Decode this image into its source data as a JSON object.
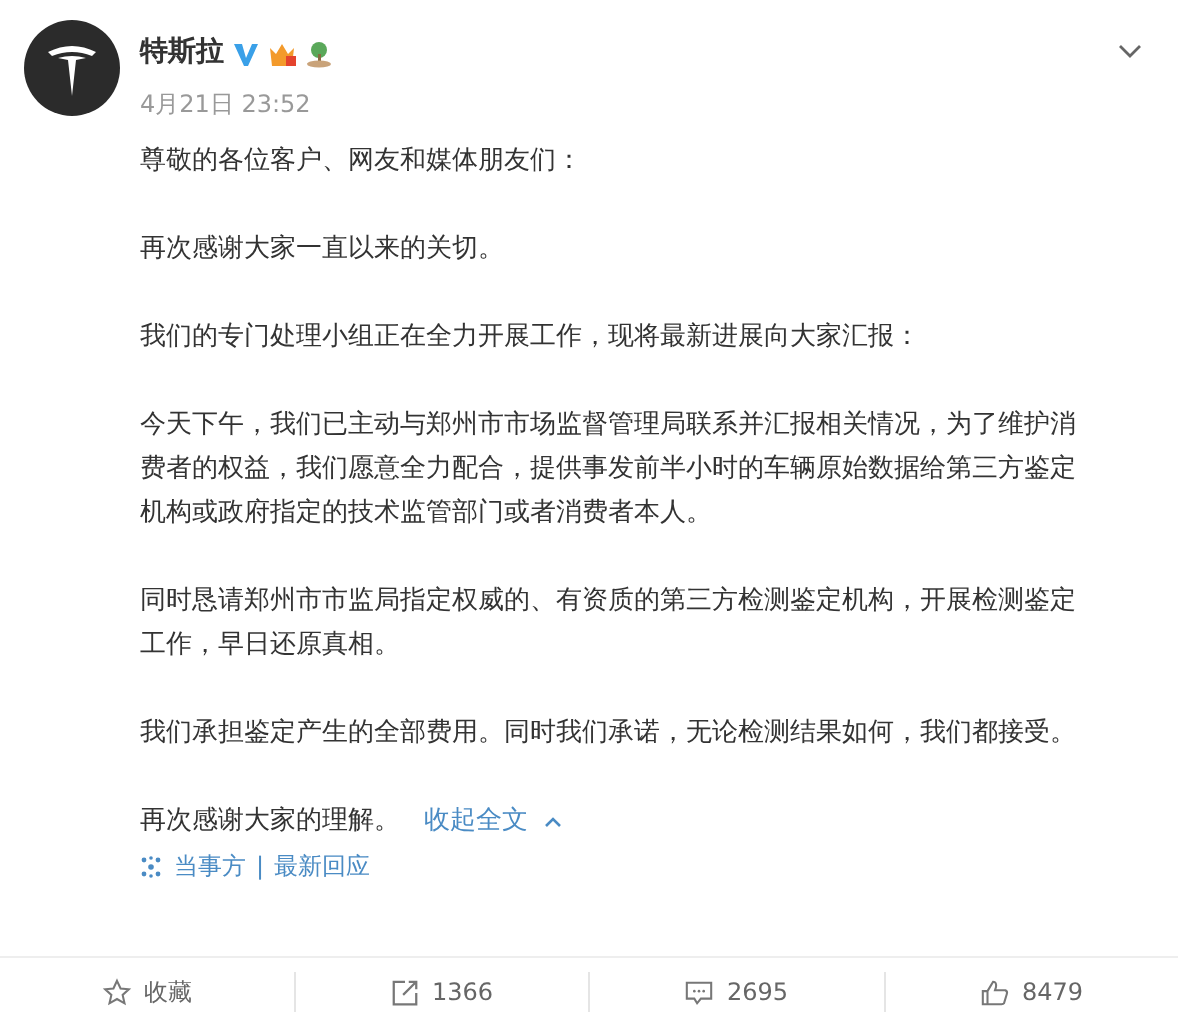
{
  "post": {
    "author": "特斯拉",
    "date": "4月21日 23:52",
    "paragraphs": [
      "尊敬的各位客户、网友和媒体朋友们：",
      "再次感谢大家一直以来的关切。",
      "我们的专门处理小组正在全力开展工作，现将最新进展向大家汇报：",
      "今天下午，我们已主动与郑州市市场监督管理局联系并汇报相关情况，为了维护消费者的权益，我们愿意全力配合，提供事发前半小时的车辆原始数据给第三方鉴定机构或政府指定的技术监管部门或者消费者本人。",
      "同时恳请郑州市市监局指定权威的、有资质的第三方检测鉴定机构，开展检测鉴定工作，早日还原真相。",
      "我们承担鉴定产生的全部费用。同时我们承诺，无论检测结果如何，我们都接受。"
    ],
    "closing": "再次感谢大家的理解。",
    "collapse_link": "收起全文",
    "source": {
      "author": "当事方",
      "separator": "|",
      "topic": "最新回应"
    }
  },
  "actions": [
    {
      "kind": "favorite",
      "label": "收藏"
    },
    {
      "kind": "repost",
      "label": "1366"
    },
    {
      "kind": "comment",
      "label": "2695"
    },
    {
      "kind": "like",
      "label": "8479"
    }
  ]
}
